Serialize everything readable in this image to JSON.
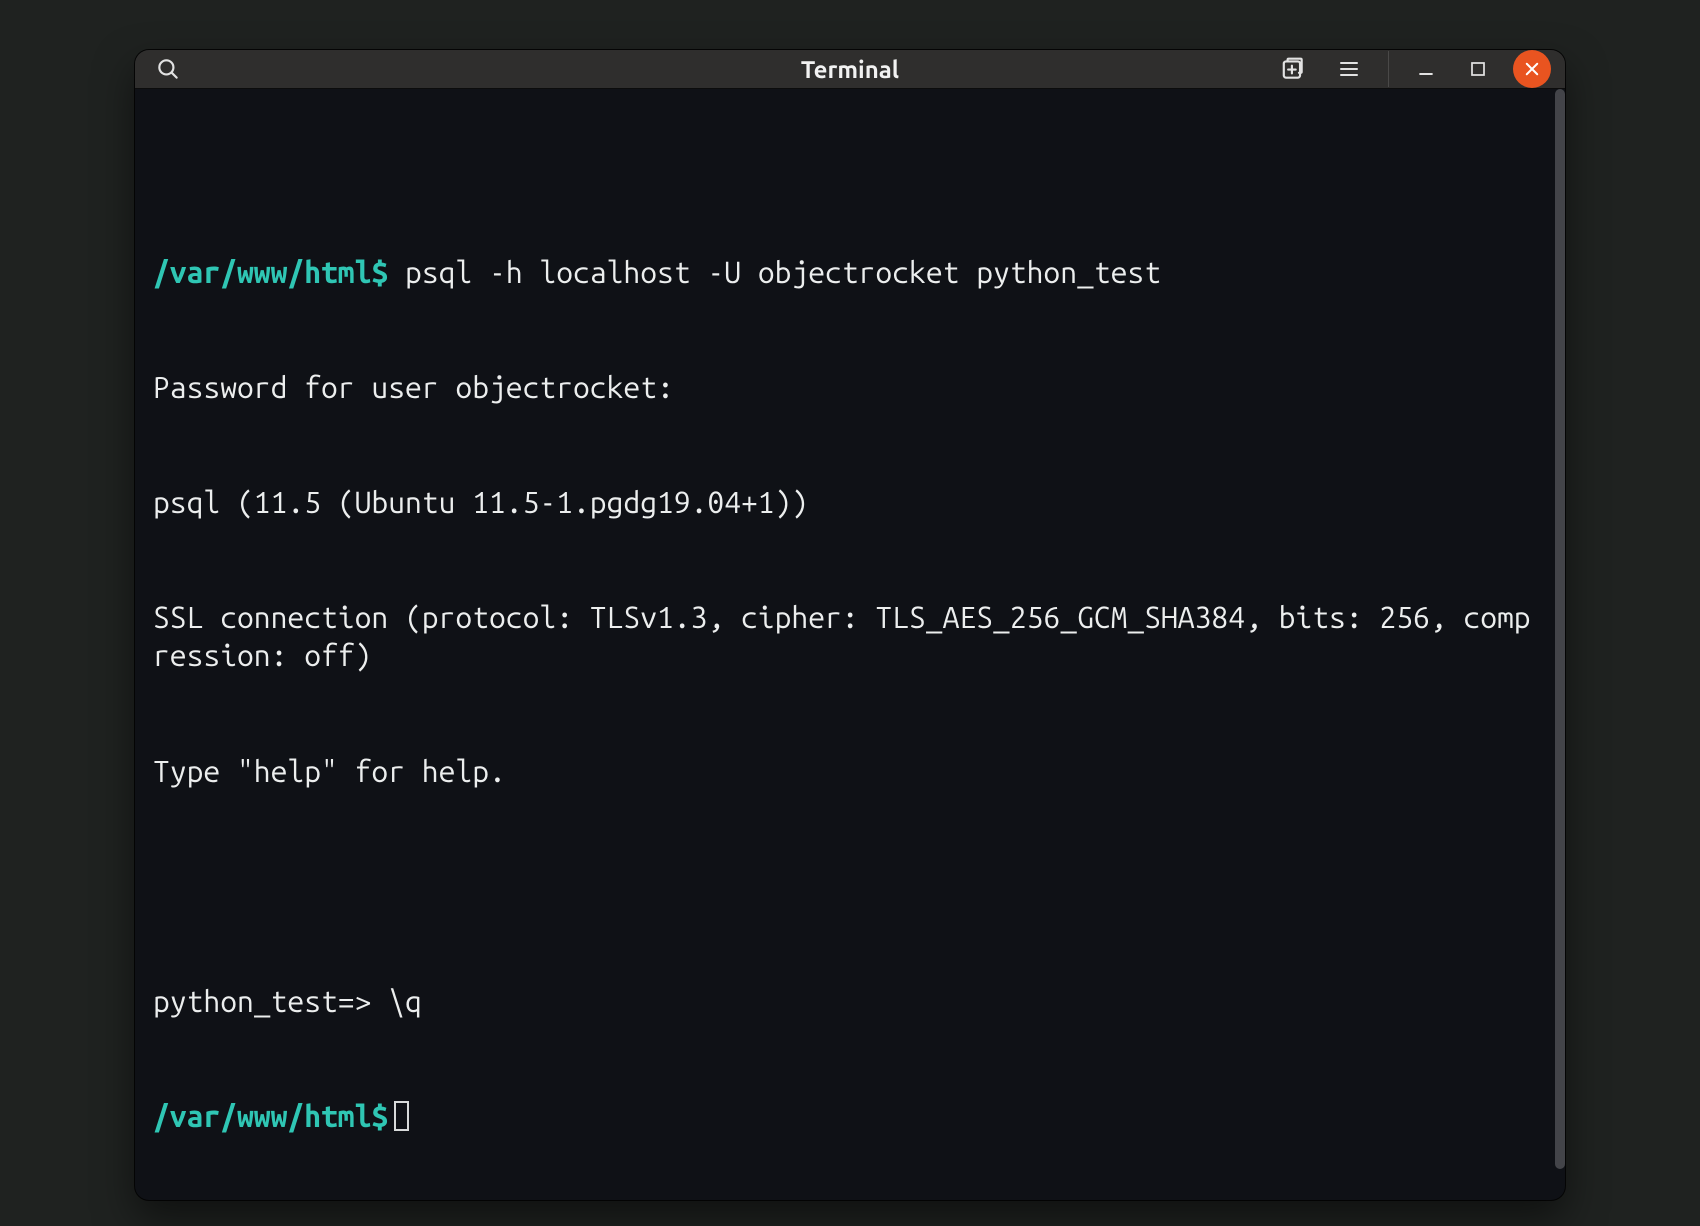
{
  "window": {
    "title": "Terminal"
  },
  "terminal": {
    "prompt1_path": "/var/www/html",
    "prompt1_dollar": "$ ",
    "cmd1": "psql -h localhost -U objectrocket python_test",
    "out1": "Password for user objectrocket:",
    "out2": "psql (11.5 (Ubuntu 11.5-1.pgdg19.04+1))",
    "out3": "SSL connection (protocol: TLSv1.3, cipher: TLS_AES_256_GCM_SHA384, bits: 256, compression: off)",
    "out4": "Type \"help\" for help.",
    "blank": " ",
    "psql_prompt": "python_test=> ",
    "psql_cmd": "\\q",
    "prompt2_path": "/var/www/html",
    "prompt2_dollar": "$"
  }
}
